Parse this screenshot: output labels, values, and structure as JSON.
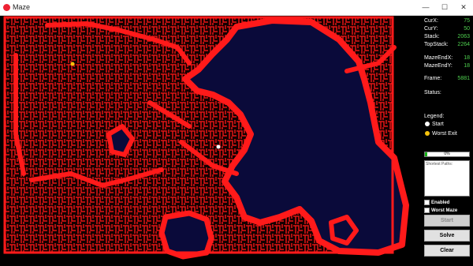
{
  "window": {
    "title": "Maze",
    "minimize": "—",
    "maximize": "☐",
    "close": "✕"
  },
  "stats": {
    "curx_label": "CurX:",
    "curx_value": "75",
    "cury_label": "CurY:",
    "cury_value": "50",
    "stack_label": "Stack:",
    "stack_value": "2063",
    "topstack_label": "TopStack:",
    "topstack_value": "2264",
    "mazeendx_label": "MazeEndX:",
    "mazeendx_value": "18",
    "mazeendy_label": "MazeEndY:",
    "mazeendy_value": "18",
    "frame_label": "Frame:",
    "frame_value": "5881",
    "status_label": "Status:"
  },
  "legend": {
    "title": "Legend:",
    "start_label": "Start",
    "worst_exit_label": "Worst Exit",
    "start_color": "#ffffff",
    "worst_exit_color": "#f4c20d"
  },
  "progress": {
    "percent_value": 0,
    "percent_text": "0%"
  },
  "paths": {
    "label": "Shortest Paths:"
  },
  "options": {
    "enabled_label": "Enabled",
    "worst_maze_label": "Worst Maze"
  },
  "buttons": {
    "start": "Start",
    "solve": "Solve",
    "clear": "Clear"
  },
  "colors": {
    "maze_wall": "#ff1a1a",
    "maze_path": "#140000",
    "unvisited": "#0a0a3a",
    "value_green": "#4fd14f"
  },
  "markers": {
    "start_icon": "white-dot",
    "worst_exit_icon": "yellow-dot"
  }
}
